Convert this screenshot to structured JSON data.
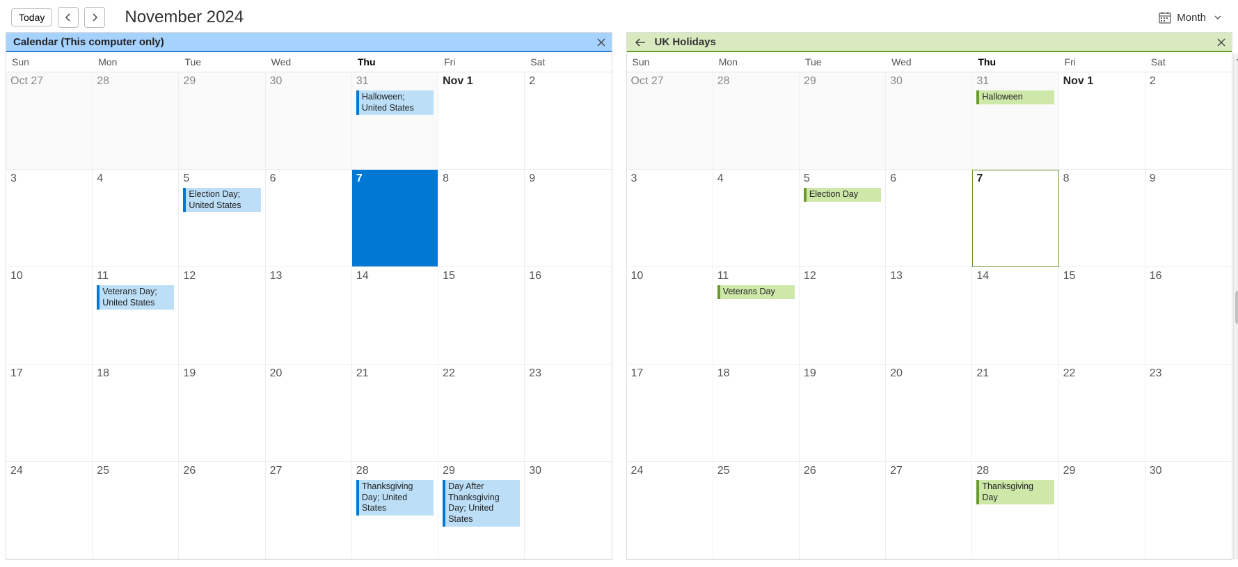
{
  "toolbar": {
    "today_label": "Today",
    "title": "November 2024",
    "view_label": "Month"
  },
  "dayHeaders": [
    "Sun",
    "Mon",
    "Tue",
    "Wed",
    "Thu",
    "Fri",
    "Sat"
  ],
  "todayDayIndex": 4,
  "panes": [
    {
      "id": "local",
      "title": "Calendar (This computer only)",
      "headerClass": "hdr-local",
      "eventClass": "ev-local",
      "hasBack": false,
      "todayMode": "selected"
    },
    {
      "id": "uk",
      "title": "UK Holidays",
      "headerClass": "hdr-uk",
      "eventClass": "ev-uk",
      "hasBack": true,
      "todayMode": "ring"
    }
  ],
  "cells": [
    {
      "num": "Oct 27",
      "out": true
    },
    {
      "num": "28",
      "out": true
    },
    {
      "num": "29",
      "out": true
    },
    {
      "num": "30",
      "out": true
    },
    {
      "num": "31",
      "out": true
    },
    {
      "num": "Nov 1",
      "bold": true
    },
    {
      "num": "2"
    },
    {
      "num": "3"
    },
    {
      "num": "4"
    },
    {
      "num": "5"
    },
    {
      "num": "6"
    },
    {
      "num": "7",
      "today": true
    },
    {
      "num": "8"
    },
    {
      "num": "9"
    },
    {
      "num": "10"
    },
    {
      "num": "11"
    },
    {
      "num": "12"
    },
    {
      "num": "13"
    },
    {
      "num": "14"
    },
    {
      "num": "15"
    },
    {
      "num": "16"
    },
    {
      "num": "17"
    },
    {
      "num": "18"
    },
    {
      "num": "19"
    },
    {
      "num": "20"
    },
    {
      "num": "21"
    },
    {
      "num": "22"
    },
    {
      "num": "23"
    },
    {
      "num": "24"
    },
    {
      "num": "25"
    },
    {
      "num": "26"
    },
    {
      "num": "27"
    },
    {
      "num": "28"
    },
    {
      "num": "29"
    },
    {
      "num": "30"
    }
  ],
  "events": {
    "local": {
      "4": [
        "Halloween; United States"
      ],
      "9": [
        "Election Day; United States"
      ],
      "15": [
        "Veterans Day; United States"
      ],
      "32": [
        "Thanksgiving Day; United States"
      ],
      "33": [
        "Day After Thanksgiving Day; United States"
      ]
    },
    "uk": {
      "4": [
        "Halloween"
      ],
      "9": [
        "Election Day"
      ],
      "15": [
        "Veterans Day"
      ],
      "32": [
        "Thanksgiving Day"
      ]
    }
  }
}
